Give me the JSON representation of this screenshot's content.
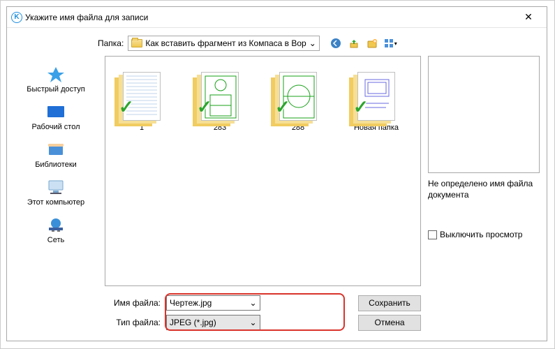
{
  "window": {
    "title": "Укажите имя файла для записи"
  },
  "folder_bar": {
    "label": "Папка:",
    "current": "Как вставить фрагмент из Компаса в Вор"
  },
  "toolbar_icons": {
    "back": "back-icon",
    "up": "up-icon",
    "newfolder": "new-folder-icon",
    "view": "view-grid-icon"
  },
  "nav": [
    {
      "key": "quick",
      "label": "Быстрый доступ"
    },
    {
      "key": "desktop",
      "label": "Рабочий стол"
    },
    {
      "key": "libs",
      "label": "Библиотеки"
    },
    {
      "key": "pc",
      "label": "Этот компьютер"
    },
    {
      "key": "network",
      "label": "Сеть"
    }
  ],
  "files": [
    {
      "name": "1"
    },
    {
      "name": "283"
    },
    {
      "name": "288"
    },
    {
      "name": "Новая папка"
    }
  ],
  "fields": {
    "name_label": "Имя файла:",
    "name_value": "Чертеж.jpg",
    "type_label": "Тип файла:",
    "type_value": "JPEG (*.jpg)"
  },
  "buttons": {
    "save": "Сохранить",
    "cancel": "Отмена"
  },
  "preview": {
    "status": "Не определено имя файла документа",
    "checkbox": "Выключить просмотр"
  }
}
